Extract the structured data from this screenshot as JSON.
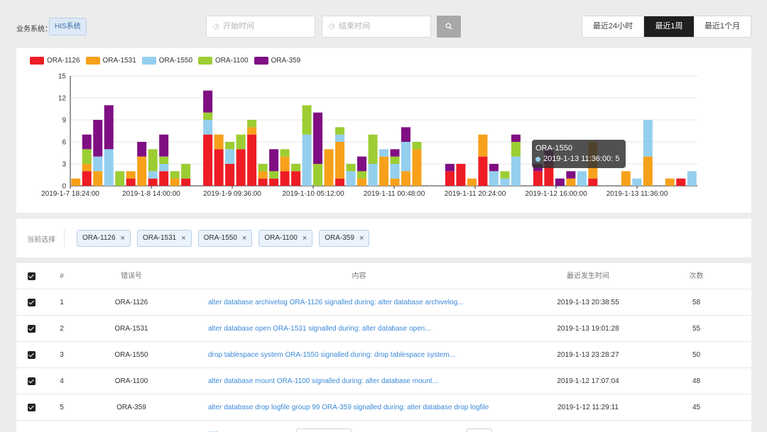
{
  "header": {
    "system_label": "业务系统：",
    "system_value": "HIS系统",
    "start_placeholder": "开始时间",
    "end_placeholder": "结束时间",
    "search_icon": "search-icon",
    "clock_icon": "clock-icon",
    "ranges": [
      {
        "label": "最近24小时",
        "active": false
      },
      {
        "label": "最近1周",
        "active": true
      },
      {
        "label": "最近1个月",
        "active": false
      }
    ]
  },
  "colors": {
    "ORA-1126": "#ee1c25",
    "ORA-1531": "#f7a11a",
    "ORA-1550": "#94cfee",
    "ORA-1100": "#9ccd33",
    "ORA-359": "#7f0f82"
  },
  "chart_data": {
    "type": "bar",
    "stacked": true,
    "title": "",
    "xlabel": "",
    "ylabel": "",
    "ylim": [
      0,
      15
    ],
    "yticks": [
      "0",
      "3",
      "6",
      "9",
      "12",
      "15"
    ],
    "x_tick_labels": [
      "2019-1-7 18:24:00",
      "2019-1-8 14:00:00",
      "2019-1-9 09:36:00",
      "2019-1-10 05:12:00",
      "2019-1-11 00:48:00",
      "2019-1-11 20:24:00",
      "2019-1-12 16:00:00",
      "2019-1-13 11:36:00"
    ],
    "legend_position": "top-left",
    "grid": true,
    "series": [
      {
        "name": "ORA-1126",
        "values": [
          0,
          2,
          0,
          0,
          0,
          1,
          0,
          1,
          2,
          0,
          1,
          0,
          7,
          5,
          3,
          5,
          7,
          1,
          1,
          2,
          2,
          0,
          0,
          0,
          1,
          0,
          0,
          0,
          0,
          0,
          0,
          0,
          0,
          0,
          2,
          3,
          0,
          4,
          0,
          0,
          0,
          0,
          2,
          3,
          0,
          0,
          0,
          1,
          0,
          0,
          0,
          0,
          0,
          0,
          0,
          1,
          0
        ]
      },
      {
        "name": "ORA-1531",
        "values": [
          1,
          1,
          2,
          0,
          0,
          1,
          4,
          0,
          0,
          1,
          0,
          0,
          0,
          2,
          0,
          0,
          1,
          1,
          0,
          2,
          0,
          0,
          0,
          5,
          5,
          0,
          1,
          0,
          4,
          1,
          2,
          5,
          0,
          0,
          0,
          0,
          1,
          3,
          0,
          0,
          0,
          0,
          0,
          0,
          0,
          1,
          0,
          5,
          0,
          0,
          2,
          0,
          4,
          0,
          1,
          0,
          0
        ]
      },
      {
        "name": "ORA-1550",
        "values": [
          0,
          0,
          2,
          5,
          0,
          0,
          0,
          1,
          1,
          0,
          0,
          0,
          2,
          0,
          2,
          0,
          0,
          0,
          0,
          0,
          0,
          7,
          0,
          0,
          1,
          2,
          0,
          3,
          1,
          2,
          4,
          0,
          0,
          0,
          0,
          0,
          0,
          0,
          2,
          1,
          4,
          0,
          0,
          0,
          0,
          0,
          2,
          0,
          0,
          0,
          0,
          1,
          5,
          0,
          0,
          0,
          2
        ]
      },
      {
        "name": "ORA-1100",
        "values": [
          0,
          2,
          0,
          0,
          2,
          0,
          0,
          3,
          1,
          1,
          2,
          0,
          1,
          0,
          1,
          2,
          1,
          1,
          1,
          1,
          1,
          4,
          3,
          0,
          1,
          1,
          1,
          4,
          0,
          1,
          0,
          1,
          0,
          0,
          0,
          0,
          0,
          0,
          0,
          1,
          2,
          0,
          0,
          0,
          0,
          0,
          0,
          0,
          0,
          0,
          0,
          0,
          0,
          0,
          0,
          0,
          0
        ]
      },
      {
        "name": "ORA-359",
        "values": [
          0,
          2,
          5,
          6,
          0,
          0,
          2,
          0,
          3,
          0,
          0,
          0,
          3,
          0,
          0,
          0,
          0,
          0,
          3,
          0,
          0,
          0,
          7,
          0,
          0,
          0,
          2,
          0,
          0,
          1,
          2,
          0,
          0,
          0,
          1,
          0,
          0,
          0,
          1,
          0,
          1,
          0,
          1,
          2,
          1,
          1,
          0,
          0,
          0,
          0,
          0,
          0,
          0,
          0,
          0,
          0,
          0
        ]
      }
    ],
    "tooltip": {
      "title": "ORA-1550",
      "line": "2019-1-13 11:36:00: 5"
    }
  },
  "filter": {
    "label": "当前选择",
    "chips": [
      "ORA-1126",
      "ORA-1531",
      "ORA-1550",
      "ORA-1100",
      "ORA-359"
    ],
    "remove_icon": "close-icon"
  },
  "table": {
    "headers": {
      "index": "#",
      "code": "错误号",
      "content": "内容",
      "time": "最近发生时间",
      "count": "次数"
    },
    "rows": [
      {
        "index": "1",
        "code": "ORA-1126",
        "content": "alter database archivelog ORA-1126 signalled during: alter database archivelog...",
        "time": "2019-1-13 20:38:55",
        "count": "58"
      },
      {
        "index": "2",
        "code": "ORA-1531",
        "content": "alter database open ORA-1531 signalled during: alter database open...",
        "time": "2019-1-13 19:01:28",
        "count": "55"
      },
      {
        "index": "3",
        "code": "ORA-1550",
        "content": "drop tablespace system ORA-1550 signalled during: drop tablespace system...",
        "time": "2019-1-13 23:28:27",
        "count": "50"
      },
      {
        "index": "4",
        "code": "ORA-1100",
        "content": "alter database mount ORA-1100 signalled during: alter database mount...",
        "time": "2019-1-12 17:07:04",
        "count": "48"
      },
      {
        "index": "5",
        "code": "ORA-359",
        "content": "alter database drop logfile group 99 ORA-359 signalled during: alter database drop logfile gro...",
        "time": "2019-1-12 11:29:11",
        "count": "45"
      }
    ]
  }
}
